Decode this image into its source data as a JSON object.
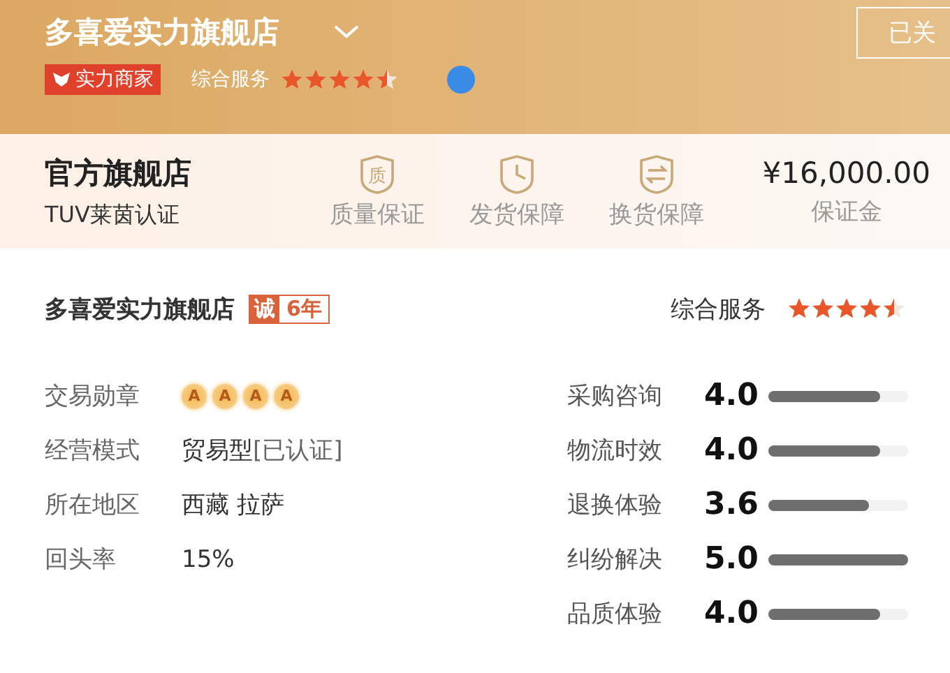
{
  "header": {
    "shop_name": "多喜爱实力旗舰店",
    "badge": "实力商家",
    "service_label": "综合服务",
    "stars": 4.5,
    "follow_button": "已关"
  },
  "guarantee": {
    "title": "官方旗舰店",
    "subtitle": "TUV莱茵认证",
    "items": [
      {
        "kind": "quality",
        "label": "质量保证",
        "glyph": "质"
      },
      {
        "kind": "delivery",
        "label": "发货保障"
      },
      {
        "kind": "exchange",
        "label": "换货保障"
      }
    ],
    "deposit": {
      "amount": "¥16,000.00",
      "label": "保证金"
    }
  },
  "shop": {
    "name": "多喜爱实力旗舰店",
    "tag_char": "诚",
    "tag_years": "6年",
    "service_label": "综合服务",
    "stars": 4.5
  },
  "info": [
    {
      "kind": "medals",
      "label": "交易勋章",
      "medals": [
        "A",
        "A",
        "A",
        "A"
      ]
    },
    {
      "kind": "text",
      "label": "经营模式",
      "value": "贸易型",
      "note": "[已认证]"
    },
    {
      "kind": "text",
      "label": "所在地区",
      "value": "西藏 拉萨"
    },
    {
      "kind": "text",
      "label": "回头率",
      "value": "15%"
    }
  ],
  "ratings": [
    {
      "label": "采购咨询",
      "score": "4.0",
      "level": 0.8
    },
    {
      "label": "物流时效",
      "score": "4.0",
      "level": 0.8
    },
    {
      "label": "退换体验",
      "score": "3.6",
      "level": 0.72
    },
    {
      "label": "纠纷解决",
      "score": "5.0",
      "level": 1.0
    },
    {
      "label": "品质体验",
      "score": "4.0",
      "level": 0.8
    }
  ]
}
